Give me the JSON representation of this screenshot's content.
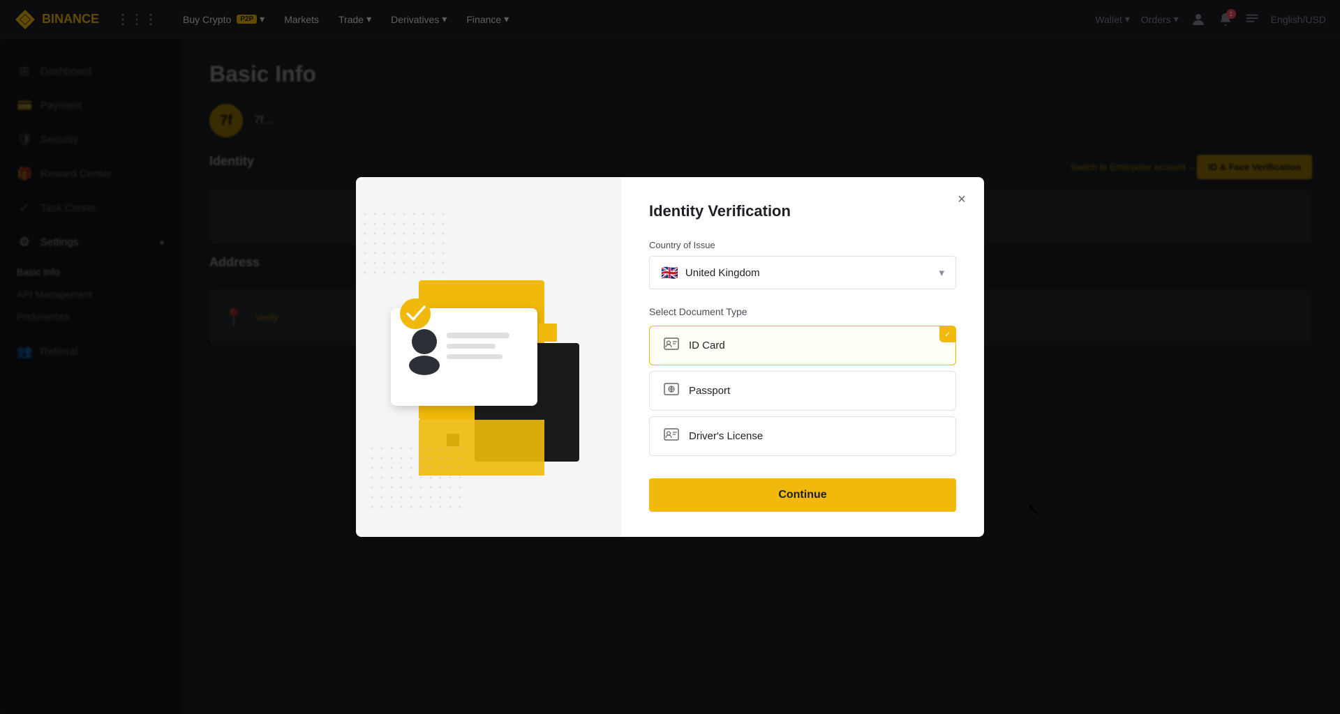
{
  "app": {
    "name": "BINANCE",
    "logo_color": "#f0b90b"
  },
  "topnav": {
    "buy_crypto": "Buy Crypto",
    "buy_crypto_badge": "P2P",
    "markets": "Markets",
    "trade": "Trade",
    "derivatives": "Derivatives",
    "finance": "Finance",
    "wallet": "Wallet",
    "orders": "Orders",
    "language": "English/USD"
  },
  "sidebar": {
    "items": [
      {
        "id": "dashboard",
        "label": "Dashboard",
        "icon": "⊞"
      },
      {
        "id": "payment",
        "label": "Payment",
        "icon": "💳"
      },
      {
        "id": "security",
        "label": "Security",
        "icon": "🛡"
      },
      {
        "id": "reward",
        "label": "Reward Center",
        "icon": "🎁"
      },
      {
        "id": "task",
        "label": "Task Center",
        "icon": "✓"
      },
      {
        "id": "settings",
        "label": "Settings",
        "icon": "⚙"
      }
    ],
    "subitems": [
      {
        "id": "basic-info",
        "label": "Basic Info"
      },
      {
        "id": "api",
        "label": "API Management"
      },
      {
        "id": "preferences",
        "label": "Preferences"
      }
    ],
    "referral": {
      "label": "Referral",
      "icon": "👥"
    }
  },
  "main": {
    "page_title": "Basic Info",
    "user_initial": "7f",
    "identity_section": "Identity",
    "switch_enterprise": "Switch to Enterprise account →",
    "id_face_btn": "ID & Face Verification",
    "address_section": "Address",
    "verify_link": "Verify"
  },
  "modal": {
    "title": "Identity Verification",
    "country_label": "Country of Issue",
    "country_value": "United Kingdom",
    "country_flag": "🇬🇧",
    "doc_type_label": "Select Document Type",
    "documents": [
      {
        "id": "id-card",
        "label": "ID Card",
        "icon": "🪪",
        "selected": true
      },
      {
        "id": "passport",
        "label": "Passport",
        "icon": "📘",
        "selected": false
      },
      {
        "id": "drivers-license",
        "label": "Driver's License",
        "icon": "🪪",
        "selected": false
      }
    ],
    "continue_btn": "Continue",
    "close_btn": "×"
  }
}
